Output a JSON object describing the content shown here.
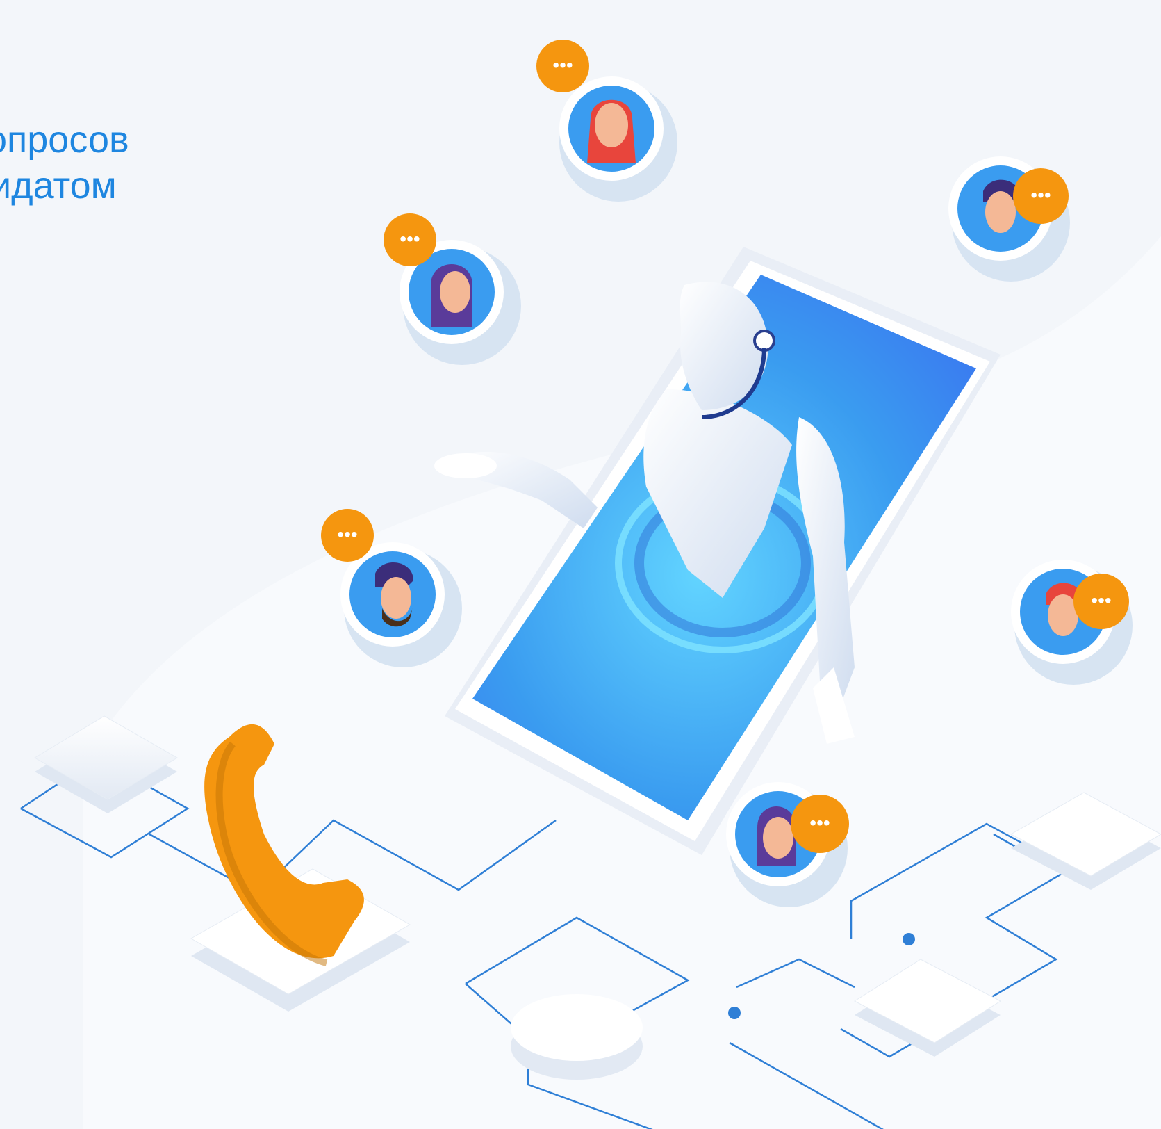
{
  "headline": {
    "line1": "опросов",
    "line2": "идатом"
  },
  "colors": {
    "background": "#f3f6fa",
    "headline": "#1e86e0",
    "accent_orange": "#f5960f",
    "phone_blue": "#3a9cf0",
    "line_blue": "#2f7fd6"
  },
  "icons": [
    "robot-icon",
    "smartphone-icon",
    "phone-handset-icon",
    "chat-bubble-icon",
    "avatar-icon",
    "network-node-icon"
  ]
}
